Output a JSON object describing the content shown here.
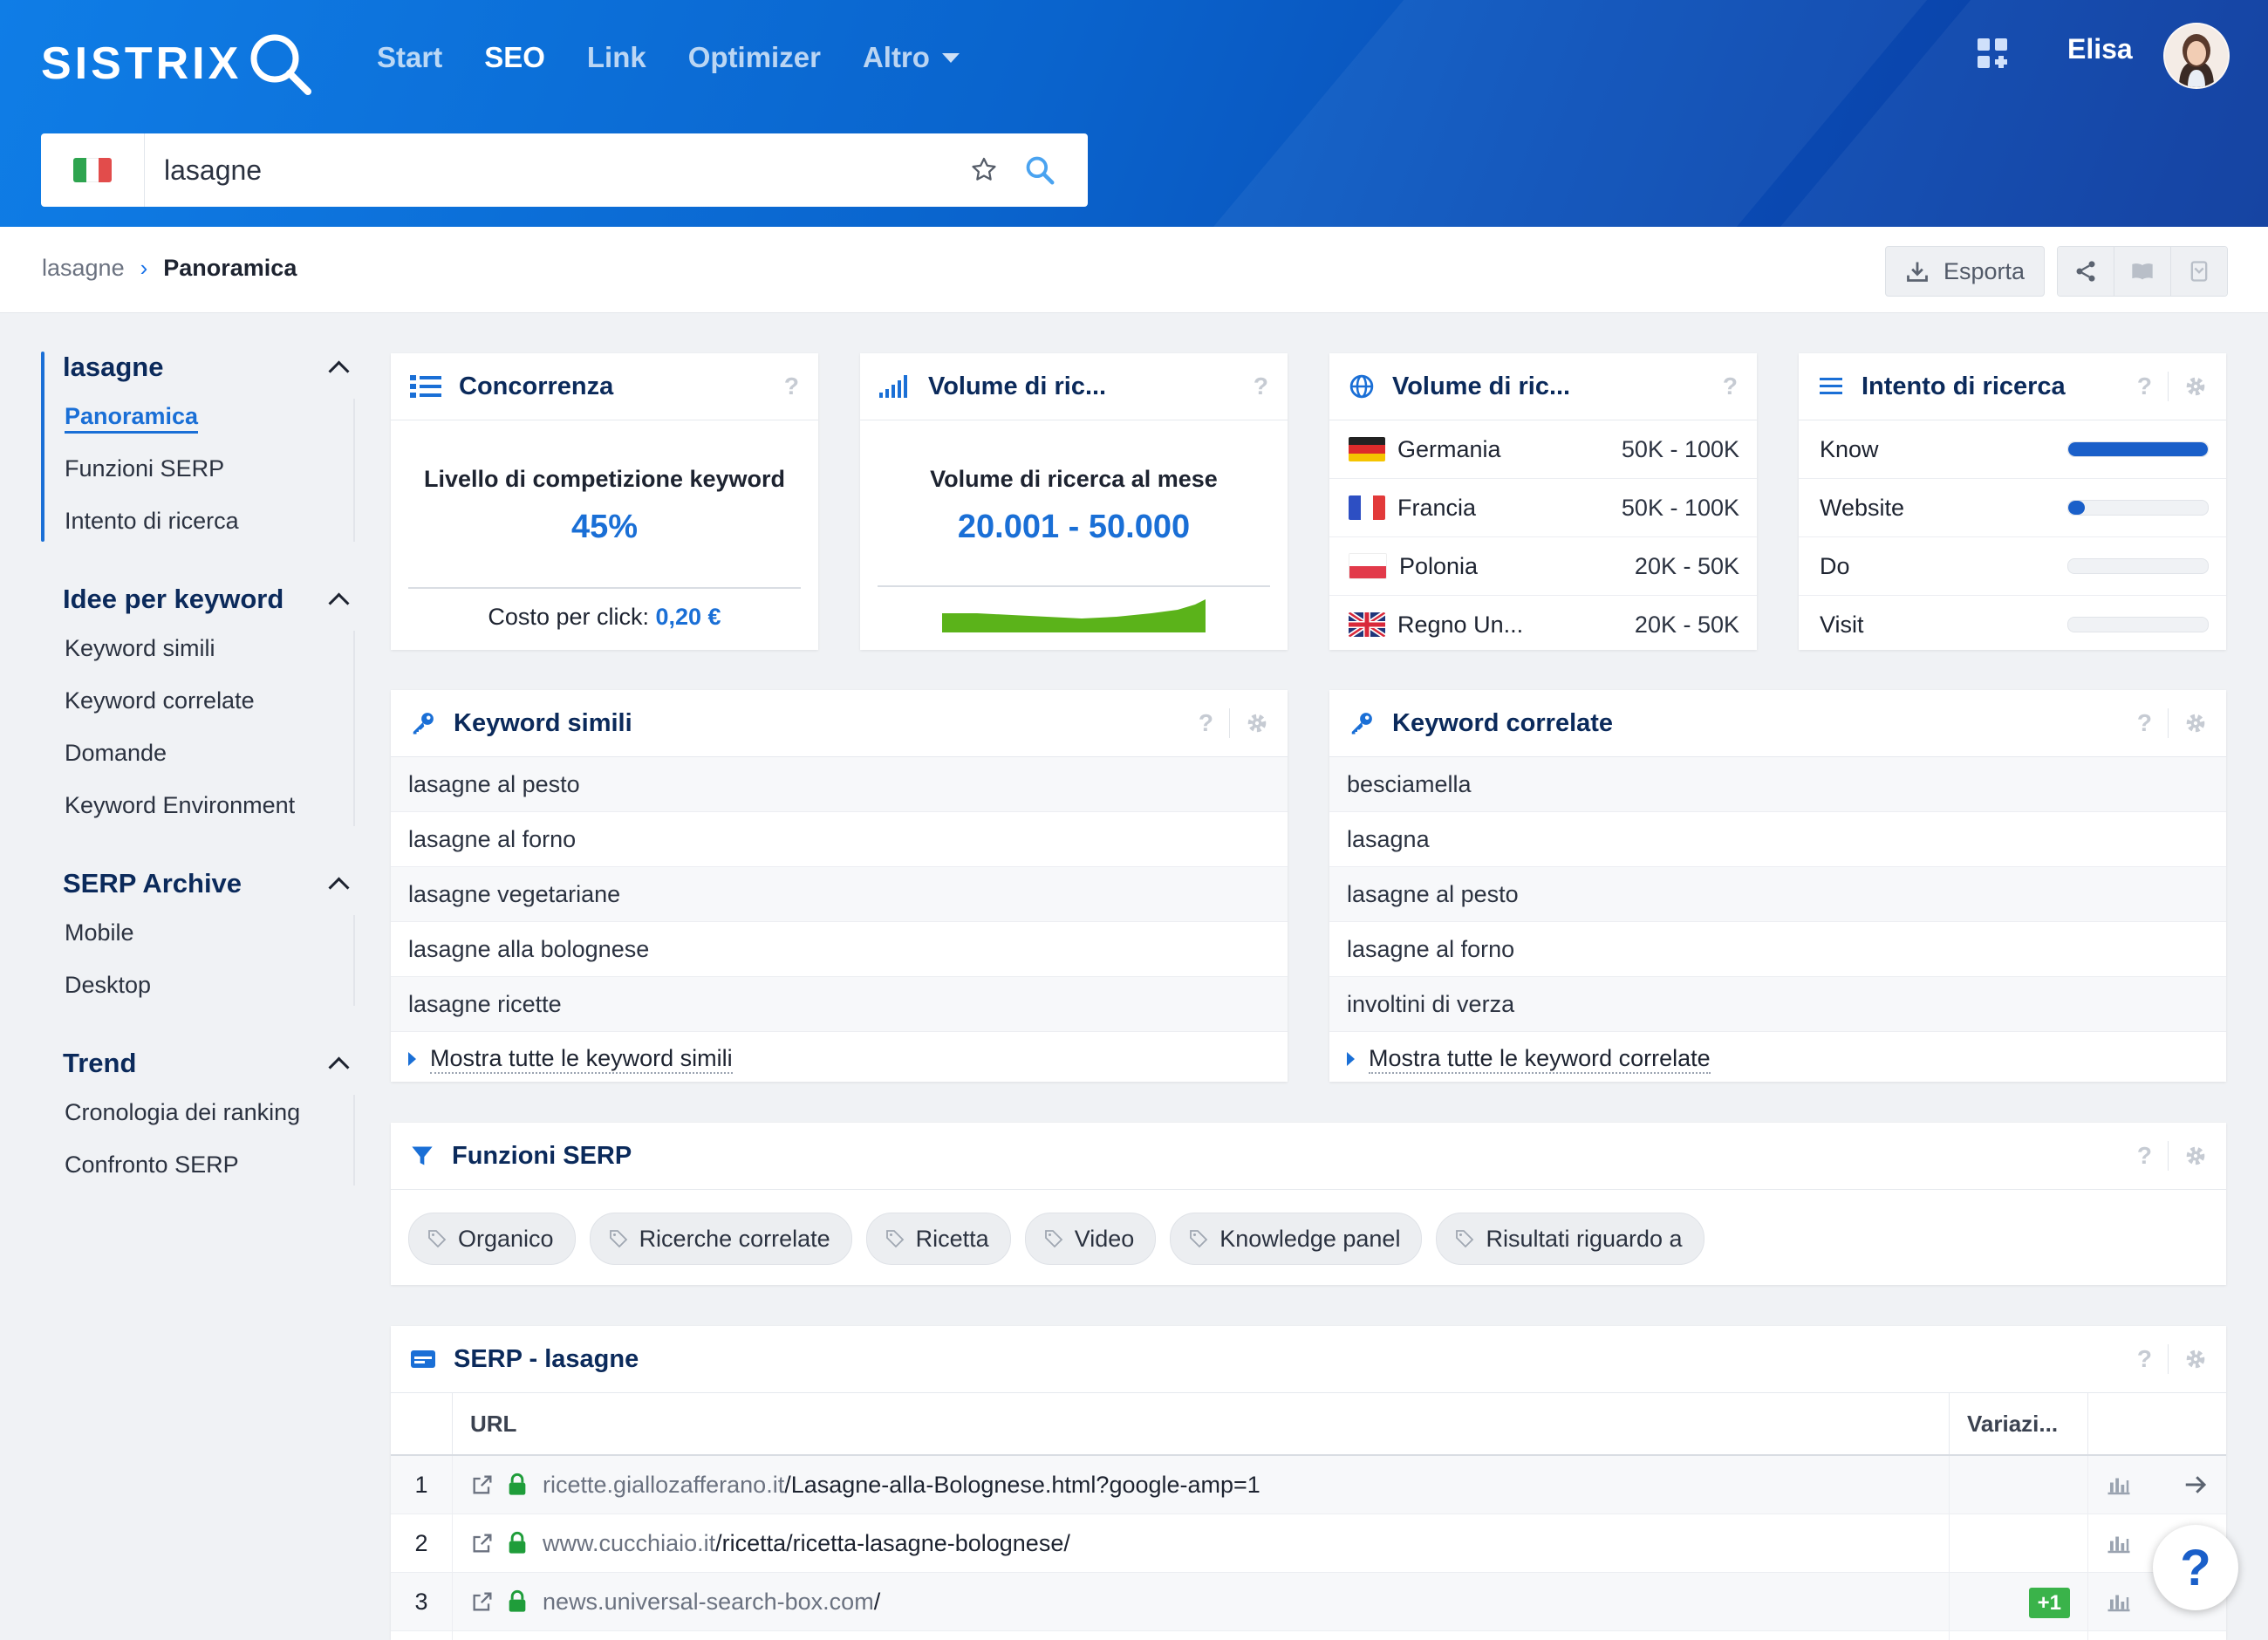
{
  "app": {
    "logo": "SISTRIX"
  },
  "nav": {
    "items": [
      "Start",
      "SEO",
      "Link",
      "Optimizer",
      "Altro"
    ]
  },
  "user": {
    "name": "Elisa"
  },
  "search": {
    "value": "lasagne",
    "country": "Italia"
  },
  "breadcrumb": {
    "root": "lasagne",
    "current": "Panoramica"
  },
  "toolbar": {
    "export_label": "Esporta"
  },
  "sidebar": {
    "sections": [
      {
        "title": "lasagne",
        "items": [
          "Panoramica",
          "Funzioni SERP",
          "Intento di ricerca"
        ]
      },
      {
        "title": "Idee per keyword",
        "items": [
          "Keyword simili",
          "Keyword correlate",
          "Domande",
          "Keyword Environment"
        ]
      },
      {
        "title": "SERP Archive",
        "items": [
          "Mobile",
          "Desktop"
        ]
      },
      {
        "title": "Trend",
        "items": [
          "Cronologia dei ranking",
          "Confronto SERP"
        ]
      }
    ]
  },
  "competition": {
    "title": "Concorrenza",
    "label": "Livello di competizione keyword",
    "value": "45%",
    "cpc_label": "Costo per click:",
    "cpc_value": "0,20 €"
  },
  "volume": {
    "title": "Volume di ric...",
    "label": "Volume di ricerca al mese",
    "value": "20.001 - 50.000"
  },
  "volume_countries": {
    "title": "Volume di ric...",
    "rows": [
      {
        "name": "Germania",
        "value": "50K - 100K"
      },
      {
        "name": "Francia",
        "value": "50K - 100K"
      },
      {
        "name": "Polonia",
        "value": "20K - 50K"
      },
      {
        "name": "Regno Un...",
        "value": "20K - 50K"
      }
    ]
  },
  "intent": {
    "title": "Intento di ricerca",
    "rows": [
      {
        "name": "Know",
        "level": 1.0
      },
      {
        "name": "Website",
        "level": 0.12
      },
      {
        "name": "Do",
        "level": 0
      },
      {
        "name": "Visit",
        "level": 0
      }
    ]
  },
  "similar": {
    "title": "Keyword simili",
    "items": [
      "lasagne al pesto",
      "lasagne al forno",
      "lasagne vegetariane",
      "lasagne alla bolognese",
      "lasagne ricette"
    ],
    "more": "Mostra tutte le keyword simili"
  },
  "related": {
    "title": "Keyword correlate",
    "items": [
      "besciamella",
      "lasagna",
      "lasagne al pesto",
      "lasagne al forno",
      "involtini di verza"
    ],
    "more": "Mostra tutte le keyword correlate"
  },
  "serp_features": {
    "title": "Funzioni SERP",
    "chips": [
      "Organico",
      "Ricerche correlate",
      "Ricetta",
      "Video",
      "Knowledge panel",
      "Risultati riguardo a"
    ]
  },
  "serp": {
    "title": "SERP - lasagne",
    "headers": {
      "url": "URL",
      "change": "Variazi..."
    },
    "rows": [
      {
        "pos": "1",
        "domain": "ricette.giallozafferano.it",
        "path": "/Lasagne-alla-Bolognese.html?google-amp=1",
        "change": ""
      },
      {
        "pos": "2",
        "domain": "www.cucchiaio.it",
        "path": "/ricetta/ricetta-lasagne-bolognese/",
        "change": ""
      },
      {
        "pos": "3",
        "domain": "news.universal-search-box.com",
        "path": "/",
        "change": "+1"
      }
    ]
  },
  "help": {
    "label": "?"
  },
  "colors": {
    "accent": "#1a6fd6",
    "header": "#0a64cd",
    "positive": "#3ab34a",
    "sparkline": "#5bb31a"
  }
}
